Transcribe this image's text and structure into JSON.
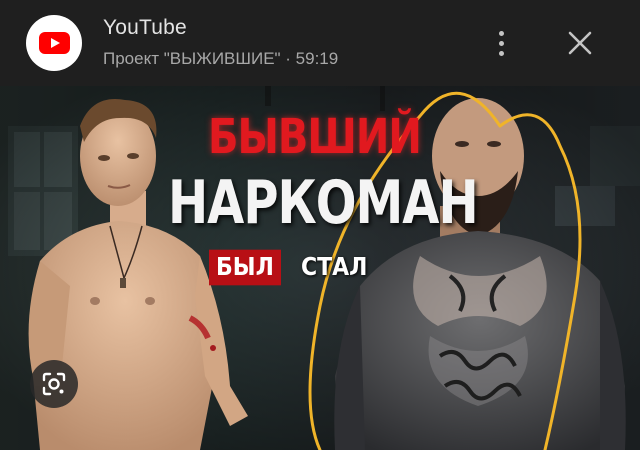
{
  "header": {
    "app_name": "YouTube",
    "subtitle": "Проект \"ВЫЖИВШИЕ\" · 59:19",
    "icons": {
      "app": "youtube-logo-icon",
      "more": "more-vert-icon",
      "close": "close-icon"
    }
  },
  "thumbnail": {
    "title_line1": "БЫВШИЙ",
    "title_line2": "НАРКОМАН",
    "tag_was": "БЫЛ",
    "tag_became": "СТАЛ",
    "lens_icon": "google-lens-icon",
    "annotation_color": "#f0b429"
  },
  "colors": {
    "background": "#1f1f1f",
    "youtube_red": "#ff0000",
    "title_red": "#e1191f"
  }
}
